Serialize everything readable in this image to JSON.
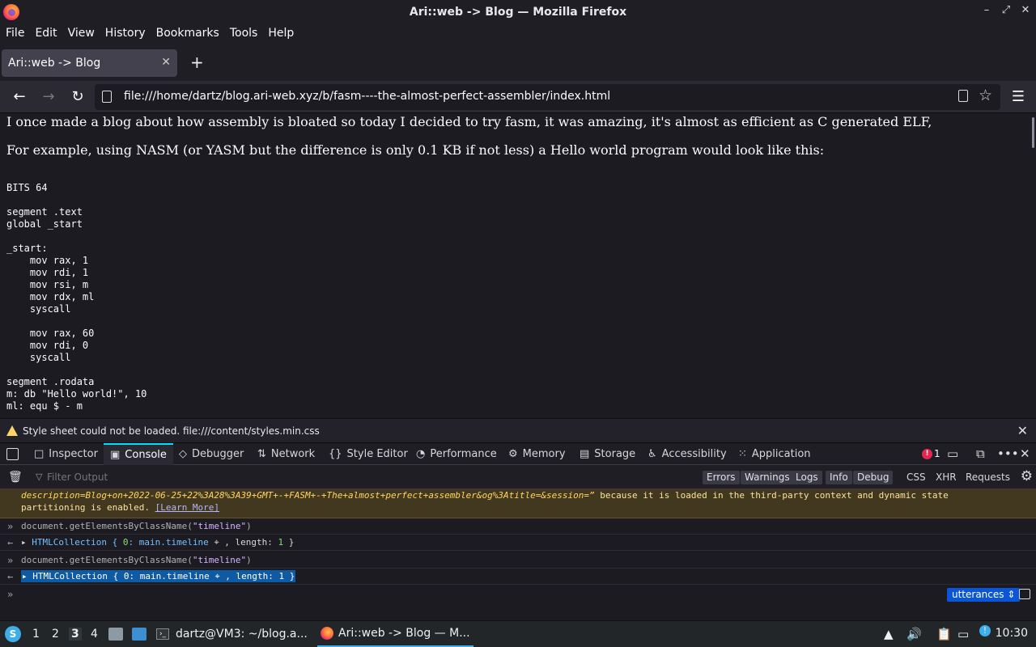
{
  "window": {
    "title": "Ari::web -> Blog — Mozilla Firefox",
    "controls": [
      "–",
      "⤢",
      "✕"
    ]
  },
  "menubar": {
    "items": [
      "File",
      "Edit",
      "View",
      "History",
      "Bookmarks",
      "Tools",
      "Help"
    ]
  },
  "tabs": [
    {
      "title": "Ari::web -> Blog",
      "active": true
    }
  ],
  "newtab_label": "+",
  "navbar": {
    "url": "file:///home/dartz/blog.ari-web.xyz/b/fasm----the-almost-perfect-assembler/index.html"
  },
  "page": {
    "para1": "I once made a blog about how assembly is bloated so today I decided to try fasm, it was amazing, it's almost as efficient as C generated ELF,",
    "para2": "For example, using NASM (or YASM but the difference is only 0.1 KB if not less) a Hello world program would look like this:",
    "code": "BITS 64\n\nsegment .text\nglobal _start\n\n_start:\n    mov rax, 1\n    mov rdi, 1\n    mov rsi, m\n    mov rdx, ml\n    syscall\n\n    mov rax, 60\n    mov rdi, 0\n    syscall\n\nsegment .rodata\nm: db \"Hello world!\", 10\nml: equ $ - m"
  },
  "warning_bar": {
    "text": "Style sheet could not be loaded. file:///content/styles.min.css"
  },
  "devtools": {
    "tabs": [
      {
        "label": "Inspector",
        "icon": "□"
      },
      {
        "label": "Console",
        "icon": "▣",
        "active": true
      },
      {
        "label": "Debugger",
        "icon": "◇"
      },
      {
        "label": "Network",
        "icon": "⇅"
      },
      {
        "label": "Style Editor",
        "icon": "{}"
      },
      {
        "label": "Performance",
        "icon": "◔"
      },
      {
        "label": "Memory",
        "icon": "⚙"
      },
      {
        "label": "Storage",
        "icon": "▤"
      },
      {
        "label": "Accessibility",
        "icon": "♿"
      },
      {
        "label": "Application",
        "icon": "⁙"
      }
    ],
    "error_count": "1",
    "filter_placeholder": "Filter Output",
    "levels": [
      "Errors",
      "Warnings",
      "Logs",
      "Info",
      "Debug"
    ],
    "extra_filters": [
      "CSS",
      "XHR",
      "Requests"
    ],
    "console": {
      "warning_line1": "description=Blog+on+2022-06-25+22%3A28%3A39+GMT+-+FASM+-+The+almost+perfect+assembler&og%3Atitle=&session=”",
      "warning_line1_rest": " because it is loaded in the third-party context and dynamic state",
      "warning_line2": "partitioning is enabled. ",
      "learn_more": "[Learn More]",
      "entries": [
        {
          "cmd_pre": "document.getElementsByClassName(",
          "cmd_arg": "\"timeline\"",
          "cmd_post": ")"
        },
        {
          "result_pre": "HTMLCollection { ",
          "result_idx": "0",
          "result_mid": ": main.timeline ",
          "result_post": " , length: ",
          "result_len": "1",
          "result_end": " }"
        },
        {
          "cmd_pre": "document.getElementsByClassName(",
          "cmd_arg": "\"timeline\"",
          "cmd_post": ")"
        },
        {
          "result_pre": "HTMLCollection { ",
          "result_idx": "0",
          "result_mid": ": main.timeline ",
          "result_post": " , length: ",
          "result_len": "1",
          "result_end": " }"
        }
      ],
      "context": "utterances ⇕"
    }
  },
  "taskbar": {
    "workspaces": [
      "1",
      "2",
      "3",
      "4"
    ],
    "active_workspace": "3",
    "tasks": [
      {
        "label": "dartz@VM3: ~/blog.a..."
      },
      {
        "label": "Ari::web -> Blog — M..."
      }
    ],
    "clock": "10:30"
  }
}
